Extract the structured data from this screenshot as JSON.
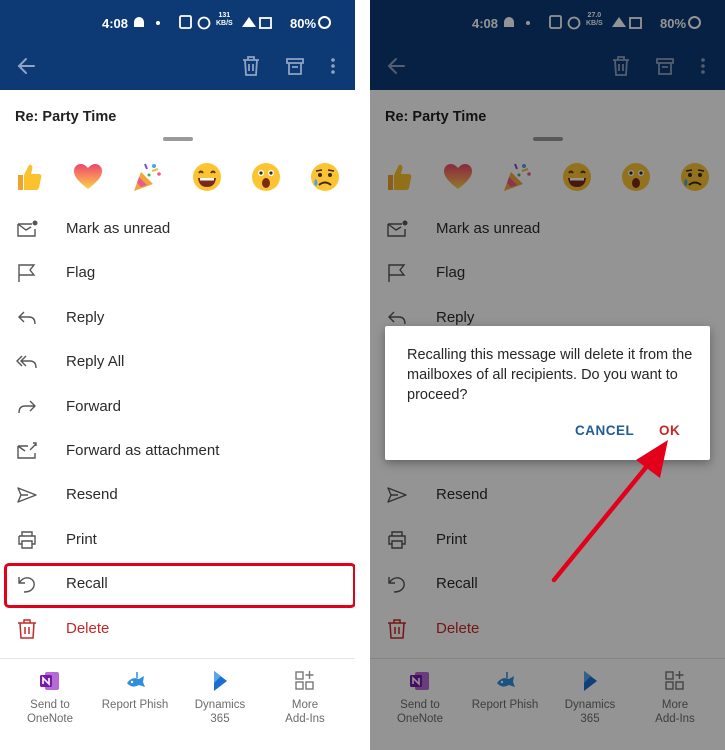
{
  "status_bar": {
    "time": "4:08",
    "left_speed": "131",
    "right_speed": "27.0",
    "speed_unit": "KB/S",
    "battery": "80%"
  },
  "email": {
    "subject": "Re: Party Time"
  },
  "reactions": [
    "thumbs-up",
    "heart",
    "party-popper",
    "grinning-face",
    "surprised-face",
    "sad-face"
  ],
  "menu": {
    "items": [
      {
        "label": "Mark as unread",
        "icon": "envelope-unread-icon"
      },
      {
        "label": "Flag",
        "icon": "flag-icon"
      },
      {
        "label": "Reply",
        "icon": "reply-icon"
      },
      {
        "label": "Reply All",
        "icon": "reply-all-icon"
      },
      {
        "label": "Forward",
        "icon": "forward-icon"
      },
      {
        "label": "Forward as attachment",
        "icon": "forward-attachment-icon"
      },
      {
        "label": "Resend",
        "icon": "resend-icon"
      },
      {
        "label": "Print",
        "icon": "printer-icon"
      },
      {
        "label": "Recall",
        "icon": "recall-icon"
      },
      {
        "label": "Delete",
        "icon": "trash-icon"
      }
    ]
  },
  "addins": [
    {
      "label": "Send to\nOneNote",
      "icon": "onenote-icon"
    },
    {
      "label": "Report Phish",
      "icon": "report-phish-icon"
    },
    {
      "label": "Dynamics\n365",
      "icon": "dynamics-365-icon"
    },
    {
      "label": "More\nAdd-Ins",
      "icon": "more-addins-icon"
    }
  ],
  "dialog": {
    "message": "Recalling this message will delete it from the mailboxes of all recipients. Do you want to proceed?",
    "cancel_label": "CANCEL",
    "ok_label": "OK"
  },
  "colors": {
    "header": "#0d3a75",
    "delete_red": "#c62828",
    "cancel_blue": "#1f5c99",
    "highlight_red": "#e3001b",
    "arrow_red": "#e3001b"
  }
}
